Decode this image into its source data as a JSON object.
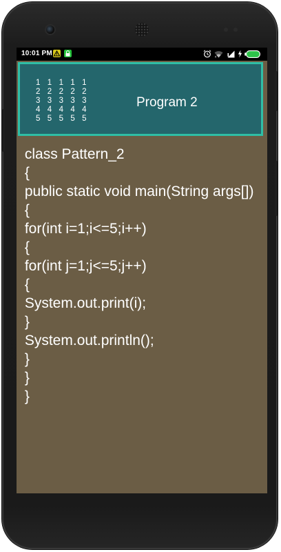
{
  "status_bar": {
    "time": "10:01 PM",
    "icons": [
      "warning-icon",
      "lock-icon",
      "alarm-icon",
      "wifi-icon",
      "signal-icon",
      "charging-icon",
      "battery-icon"
    ],
    "colors": {
      "warning": "#d8c81a",
      "lock": "#25c23b",
      "battery": "#2ec24a"
    }
  },
  "header": {
    "title": "Program 2",
    "pattern_rows": [
      "1 1 1 1 1",
      "2 2 2 2 2",
      "3 3 3 3 3",
      "4 4 4 4 4",
      "5 5 5 5 5"
    ],
    "colors": {
      "background": "#24666c",
      "border": "#2fbfa6"
    }
  },
  "code": {
    "lines": [
      " class Pattern_2",
      " {",
      " public static void main(String args[])",
      " {",
      " for(int i=1;i<=5;i++)",
      " {",
      " for(int j=1;j<=5;j++)",
      " {",
      " System.out.print(i);",
      " }",
      " System.out.println();",
      " }",
      " }",
      " }"
    ],
    "colors": {
      "background": "#6b5d45",
      "text": "#ffffff"
    }
  }
}
